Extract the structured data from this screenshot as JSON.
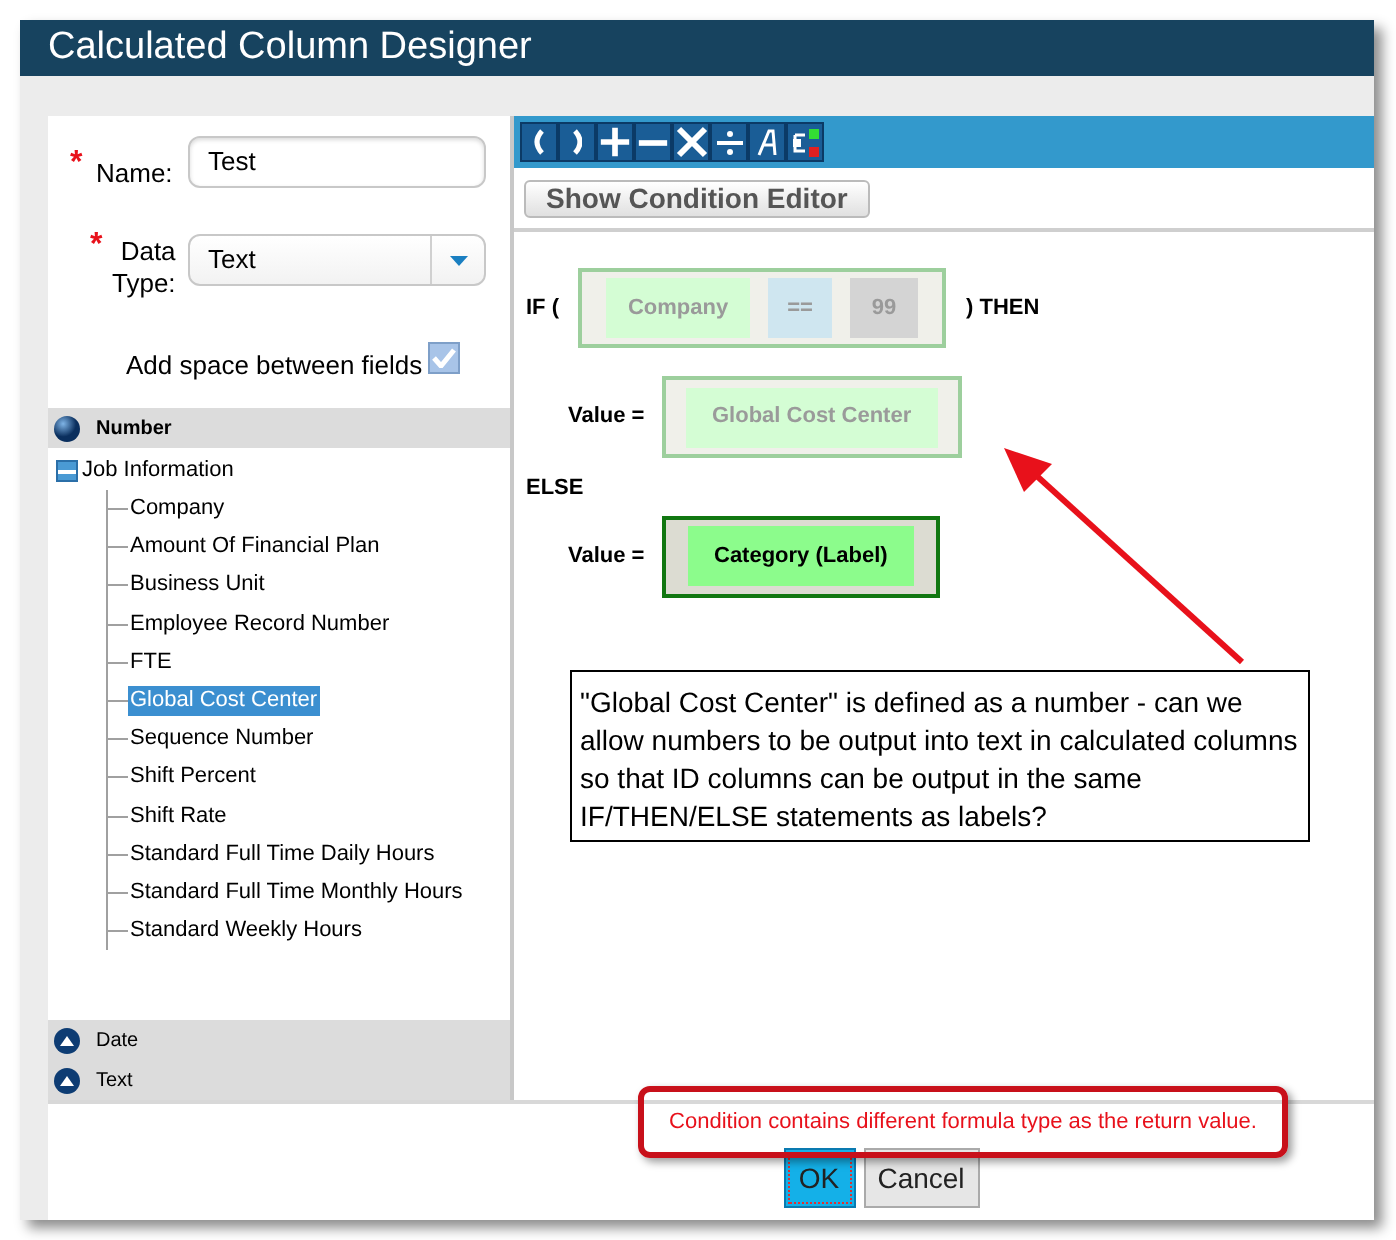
{
  "window": {
    "title": "Calculated Column Designer"
  },
  "form": {
    "name": {
      "label": "Name:",
      "value": "Test",
      "required_mark": "*"
    },
    "data_type": {
      "label_lines": [
        "Data",
        "Type:"
      ],
      "value": "Text",
      "required_mark": "*"
    },
    "add_space": {
      "label": "Add space between fields",
      "checked": true
    }
  },
  "tree": [
    {
      "label": "Number",
      "expanded": true,
      "children": [
        {
          "label": "Job Information",
          "expanded": true,
          "children": [
            {
              "label": "Company",
              "selected": false
            },
            {
              "label": "Amount Of Financial Plan",
              "selected": false
            },
            {
              "label": "Business Unit",
              "selected": false
            },
            {
              "label": "Employee Record Number",
              "selected": false
            },
            {
              "label": "FTE",
              "selected": false
            },
            {
              "label": "Global Cost Center",
              "selected": true
            },
            {
              "label": "Sequence Number",
              "selected": false
            },
            {
              "label": "Shift Percent",
              "selected": false
            },
            {
              "label": "Shift Rate",
              "selected": false
            },
            {
              "label": "Standard Full Time Daily Hours",
              "selected": false
            },
            {
              "label": "Standard Full Time Monthly Hours",
              "selected": false
            },
            {
              "label": "Standard Weekly Hours",
              "selected": false
            }
          ]
        }
      ]
    },
    {
      "label": "Date",
      "expanded": false
    },
    {
      "label": "Text",
      "expanded": false
    }
  ],
  "toolbar": [
    {
      "kind": "open-paren"
    },
    {
      "kind": "close-paren"
    },
    {
      "kind": "plus"
    },
    {
      "kind": "minus"
    },
    {
      "kind": "times"
    },
    {
      "kind": "divide"
    },
    {
      "kind": "text"
    },
    {
      "kind": "node"
    }
  ],
  "condition_editor_button": "Show Condition Editor",
  "formula": {
    "if_label": "IF (",
    "then_label": ") THEN",
    "condition": [
      {
        "text": "Company",
        "kind": "field"
      },
      {
        "text": "==",
        "kind": "operator"
      },
      {
        "text": "99",
        "kind": "constant"
      }
    ],
    "then_value_label": "Value =",
    "then_value": {
      "text": "Global Cost Center",
      "active": false
    },
    "else_label": "ELSE",
    "else_value_label": "Value =",
    "else_value": {
      "text": "Category (Label)",
      "active": true
    }
  },
  "callout": "\"Global Cost Center\" is defined as a number - can we allow numbers to be output into text in calculated columns so that ID columns can be output in the same IF/THEN/ELSE statements as labels?",
  "error_message": "Condition contains different formula type as the return value.",
  "buttons": [
    {
      "label": "OK",
      "kind": "primary",
      "focused": true
    },
    {
      "label": "Cancel",
      "kind": "secondary",
      "focused": false
    }
  ]
}
